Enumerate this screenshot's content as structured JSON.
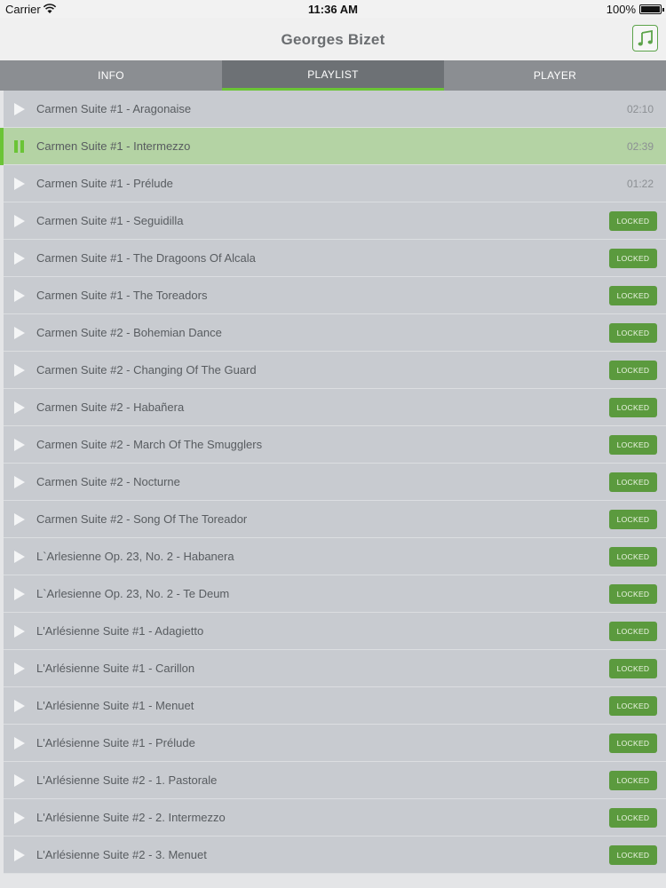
{
  "status_bar": {
    "carrier": "Carrier",
    "time": "11:36 AM",
    "battery": "100%"
  },
  "header": {
    "title": "Georges Bizet",
    "music_icon": "music-note-icon"
  },
  "tabs": [
    {
      "label": "INFO",
      "active": false
    },
    {
      "label": "PLAYLIST",
      "active": true
    },
    {
      "label": "PLAYER",
      "active": false
    }
  ],
  "colors": {
    "accent": "#6bc436",
    "locked_badge": "#5b9a3e",
    "row_bg": "#c8cbd0",
    "active_row_bg": "#b4d3a4"
  },
  "tracks": [
    {
      "title": "Carmen Suite #1 - Aragonaise",
      "duration": "02:10",
      "state": "play"
    },
    {
      "title": "Carmen Suite #1 - Intermezzo",
      "duration": "02:39",
      "state": "playing"
    },
    {
      "title": "Carmen Suite #1 - Prélude",
      "duration": "01:22",
      "state": "play"
    },
    {
      "title": "Carmen Suite #1 - Seguidilla",
      "badge": "LOCKED",
      "state": "locked"
    },
    {
      "title": "Carmen Suite #1 - The Dragoons Of Alcala",
      "badge": "LOCKED",
      "state": "locked"
    },
    {
      "title": "Carmen Suite #1 - The Toreadors",
      "badge": "LOCKED",
      "state": "locked"
    },
    {
      "title": "Carmen Suite #2 - Bohemian Dance",
      "badge": "LOCKED",
      "state": "locked"
    },
    {
      "title": "Carmen Suite #2 - Changing Of The Guard",
      "badge": "LOCKED",
      "state": "locked"
    },
    {
      "title": "Carmen Suite #2 - Habañera",
      "badge": "LOCKED",
      "state": "locked"
    },
    {
      "title": "Carmen Suite #2 - March Of The Smugglers",
      "badge": "LOCKED",
      "state": "locked"
    },
    {
      "title": "Carmen Suite #2 - Nocturne",
      "badge": "LOCKED",
      "state": "locked"
    },
    {
      "title": "Carmen Suite #2 - Song Of The Toreador",
      "badge": "LOCKED",
      "state": "locked"
    },
    {
      "title": "L`Arlesienne Op. 23, No. 2 - Habanera",
      "badge": "LOCKED",
      "state": "locked"
    },
    {
      "title": "L`Arlesienne Op. 23, No. 2 - Te Deum",
      "badge": "LOCKED",
      "state": "locked"
    },
    {
      "title": "L'Arlésienne Suite #1 - Adagietto",
      "badge": "LOCKED",
      "state": "locked"
    },
    {
      "title": "L'Arlésienne Suite #1 - Carillon",
      "badge": "LOCKED",
      "state": "locked"
    },
    {
      "title": "L'Arlésienne Suite #1 - Menuet",
      "badge": "LOCKED",
      "state": "locked"
    },
    {
      "title": "L'Arlésienne Suite #1 - Prélude",
      "badge": "LOCKED",
      "state": "locked"
    },
    {
      "title": "L'Arlésienne Suite #2 - 1. Pastorale",
      "badge": "LOCKED",
      "state": "locked"
    },
    {
      "title": "L'Arlésienne Suite #2 - 2. Intermezzo",
      "badge": "LOCKED",
      "state": "locked"
    },
    {
      "title": "L'Arlésienne Suite #2 - 3. Menuet",
      "badge": "LOCKED",
      "state": "locked"
    }
  ]
}
